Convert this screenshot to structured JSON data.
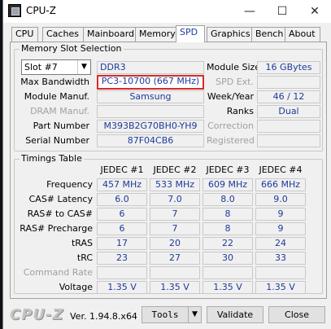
{
  "window": {
    "title": "CPU-Z",
    "controls": {
      "minimize": "—",
      "maximize": "☐",
      "close": "✕"
    }
  },
  "tabs": [
    {
      "label": "CPU"
    },
    {
      "label": "Caches"
    },
    {
      "label": "Mainboard"
    },
    {
      "label": "Memory"
    },
    {
      "label": "SPD",
      "active": true
    },
    {
      "label": "Graphics"
    },
    {
      "label": "Bench"
    },
    {
      "label": "About"
    }
  ],
  "slot_section": {
    "title": "Memory Slot Selection",
    "slot_selected": "Slot #7",
    "type": "DDR3",
    "module_size_label": "Module Size",
    "module_size": "16 GBytes",
    "max_bandwidth_label": "Max Bandwidth",
    "max_bandwidth": "PC3-10700 (667 MHz)",
    "spd_ext_label": "SPD Ext.",
    "spd_ext": "",
    "module_manuf_label": "Module Manuf.",
    "module_manuf": "Samsung",
    "week_year_label": "Week/Year",
    "week_year": "46 / 12",
    "dram_manuf_label": "DRAM Manuf.",
    "dram_manuf": "",
    "ranks_label": "Ranks",
    "ranks": "Dual",
    "part_number_label": "Part Number",
    "part_number": "M393B2G70BH0-YH9",
    "correction_label": "Correction",
    "correction": "",
    "serial_number_label": "Serial Number",
    "serial_number": "87F04CB6",
    "registered_label": "Registered",
    "registered": ""
  },
  "timings_section": {
    "title": "Timings Table",
    "columns": [
      "JEDEC #1",
      "JEDEC #2",
      "JEDEC #3",
      "JEDEC #4"
    ],
    "rows": [
      {
        "label": "Frequency",
        "values": [
          "457 MHz",
          "533 MHz",
          "609 MHz",
          "666 MHz"
        ]
      },
      {
        "label": "CAS# Latency",
        "values": [
          "6.0",
          "7.0",
          "8.0",
          "9.0"
        ]
      },
      {
        "label": "RAS# to CAS#",
        "values": [
          "6",
          "7",
          "8",
          "9"
        ]
      },
      {
        "label": "RAS# Precharge",
        "values": [
          "6",
          "7",
          "8",
          "9"
        ]
      },
      {
        "label": "tRAS",
        "values": [
          "17",
          "20",
          "22",
          "24"
        ]
      },
      {
        "label": "tRC",
        "values": [
          "23",
          "27",
          "30",
          "33"
        ]
      },
      {
        "label": "Command Rate",
        "values": [
          "",
          "",
          "",
          ""
        ],
        "dim": true
      },
      {
        "label": "Voltage",
        "values": [
          "1.35 V",
          "1.35 V",
          "1.35 V",
          "1.35 V"
        ]
      }
    ]
  },
  "footer": {
    "logo": "CPU-Z",
    "version": "Ver. 1.94.8.x64",
    "tools_label": "Tools",
    "validate_label": "Validate",
    "close_label": "Close"
  }
}
